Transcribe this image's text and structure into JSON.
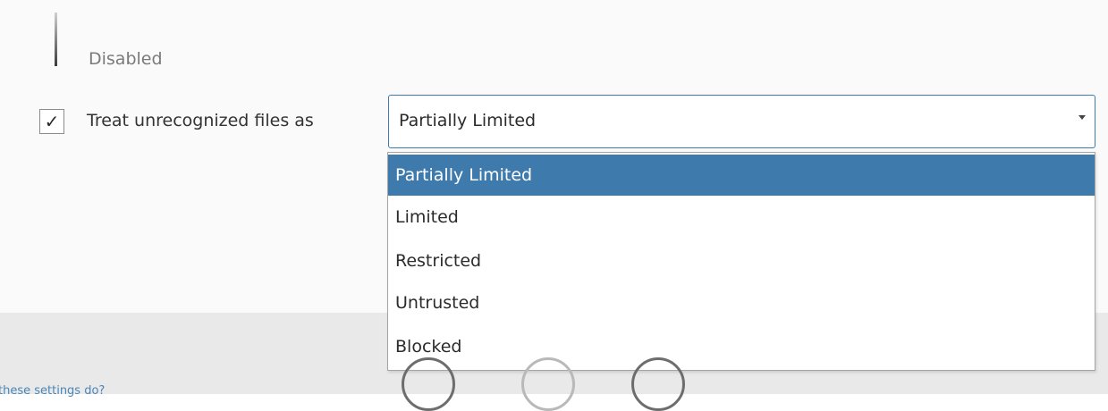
{
  "security_level": {
    "current_label": "Disabled"
  },
  "unrecognized_files": {
    "checked": true,
    "checkbox_glyph": "✓",
    "label": "Treat unrecognized files as",
    "selected_value": "Partially Limited",
    "options": [
      "Partially Limited",
      "Limited",
      "Restricted",
      "Untrusted",
      "Blocked"
    ],
    "highlighted_index": 0
  },
  "footer": {
    "help_link_text": "these settings do?"
  },
  "colors": {
    "accent": "#3e7aab",
    "panel_background": "#fafafa",
    "footer_background": "#e9e9e9",
    "muted_text": "#7a7a7a"
  },
  "icons": {
    "checkbox": "check-icon",
    "select_arrow": "chevron-down-icon"
  }
}
